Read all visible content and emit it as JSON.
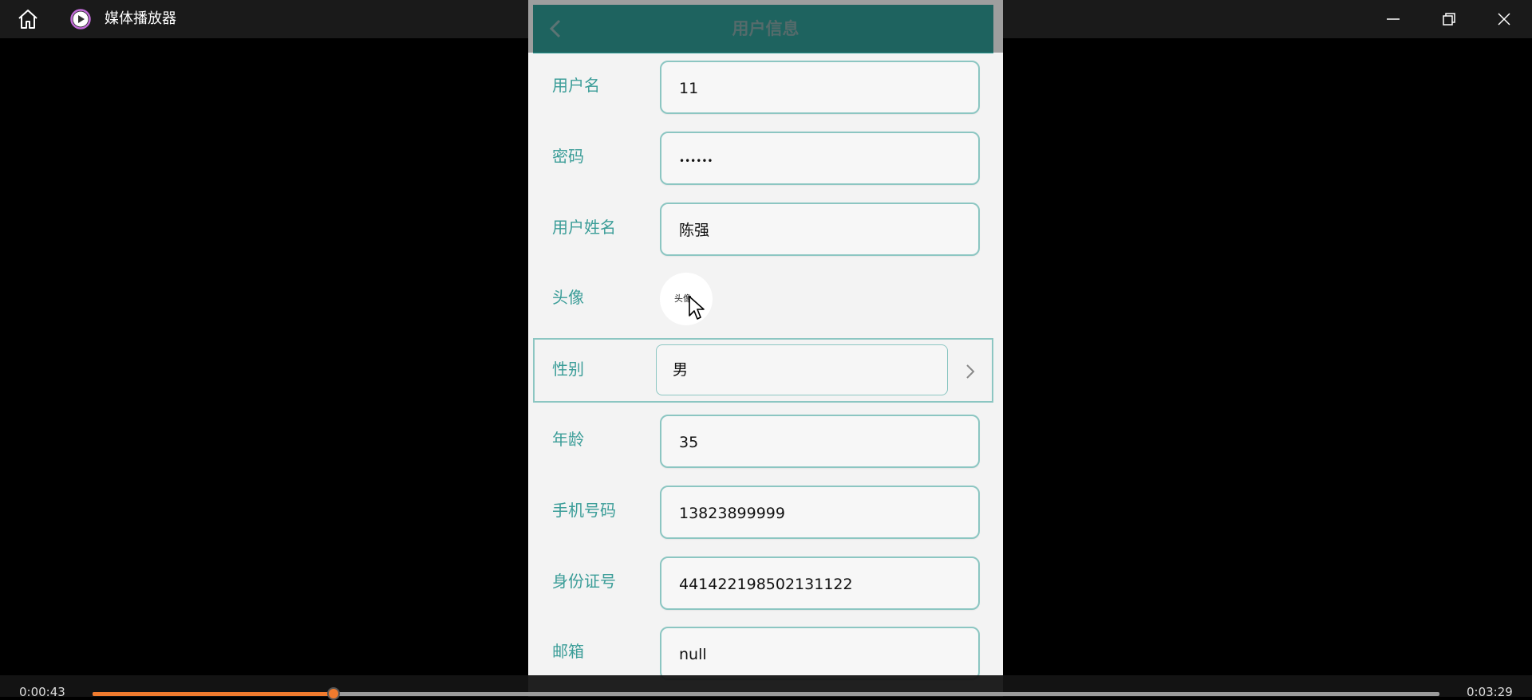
{
  "window": {
    "title": "媒体播放器",
    "icons": {
      "home": "home-icon",
      "app": "play-circle-icon",
      "minimize": "minimize-icon",
      "restore": "restore-icon",
      "close": "close-icon"
    }
  },
  "app": {
    "header_title": "用户信息",
    "back_icon": "chevron-left-icon",
    "accent_color": "#2e9893",
    "fields": [
      {
        "label": "用户名",
        "value": "11"
      },
      {
        "label": "密码",
        "value": "••••••"
      },
      {
        "label": "用户姓名",
        "value": "陈强"
      },
      {
        "label": "头像",
        "value": "头像"
      },
      {
        "label": "性别",
        "value": "男"
      },
      {
        "label": "年龄",
        "value": "35"
      },
      {
        "label": "手机号码",
        "value": "13823899999"
      },
      {
        "label": "身份证号",
        "value": "441422198502131122"
      },
      {
        "label": "邮箱",
        "value": "null"
      }
    ]
  },
  "player": {
    "current_time": "0:00:43",
    "total_time": "0:03:29",
    "progress_fraction": 0.179,
    "progress_color": "#f07b2e"
  }
}
